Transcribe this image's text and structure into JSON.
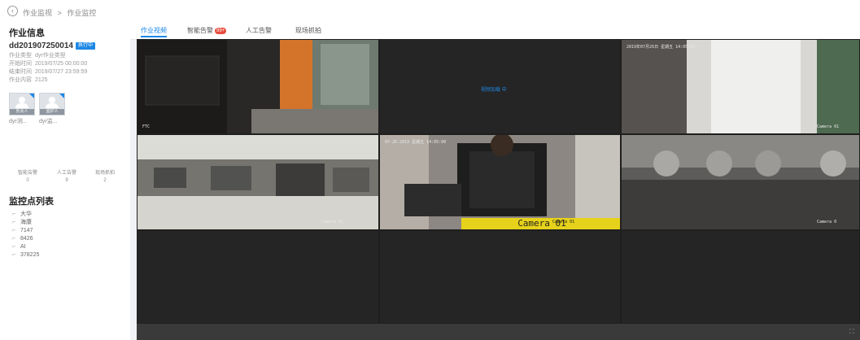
{
  "breadcrumb": {
    "back_icon": "back-circle-icon",
    "items": [
      "作业监视",
      "作业监控"
    ]
  },
  "sidebar": {
    "job_info_title": "作业信息",
    "job_id": "dd201907250014",
    "job_status": "执行中",
    "info_rows": [
      {
        "label": "作业类型",
        "value": "dyr作业类型"
      },
      {
        "label": "开始时间",
        "value": "2019/07/25 00:00:00"
      },
      {
        "label": "结束时间",
        "value": "2019/07/27 23:59:59"
      },
      {
        "label": "作业内容",
        "value": "2125"
      }
    ],
    "people": [
      {
        "role": "负责人",
        "name": "dyr测..."
      },
      {
        "role": "监护人",
        "name": "dyr监..."
      }
    ],
    "stats": [
      {
        "label": "智能告警",
        "value": "0"
      },
      {
        "label": "人工告警",
        "value": "9"
      },
      {
        "label": "现场抓拍",
        "value": "2"
      }
    ],
    "point_list_title": "监控点列表",
    "points": [
      "大华",
      "海康",
      "7147",
      "8426",
      "AI",
      "378225"
    ]
  },
  "tabs": [
    {
      "label": "作业视频",
      "active": true
    },
    {
      "label": "智能告警",
      "badge": "99+"
    },
    {
      "label": "人工告警"
    },
    {
      "label": "现场抓拍"
    }
  ],
  "video": {
    "cells": [
      {
        "type": "feed",
        "osd": [
          "FTC"
        ]
      },
      {
        "type": "loading",
        "text": "视频加载",
        "status": "中"
      },
      {
        "type": "feed",
        "osd": [
          "2019年07月26日 星期五 14:05:03",
          "Camera 01"
        ]
      },
      {
        "type": "feed",
        "osd": [
          "Camera 01"
        ]
      },
      {
        "type": "feed",
        "osd": [
          "07-26-2019 星期五 14:05:00",
          "Camera 01",
          "Camera 01"
        ]
      },
      {
        "type": "feed",
        "osd": [
          "Camera 0"
        ]
      },
      {
        "type": "empty"
      },
      {
        "type": "empty"
      },
      {
        "type": "empty"
      }
    ],
    "fullscreen_icon": "fullscreen-icon"
  },
  "colors": {
    "accent": "#1e88e5",
    "badge": "#e74c3c",
    "camera_label": "#e6d21a"
  }
}
